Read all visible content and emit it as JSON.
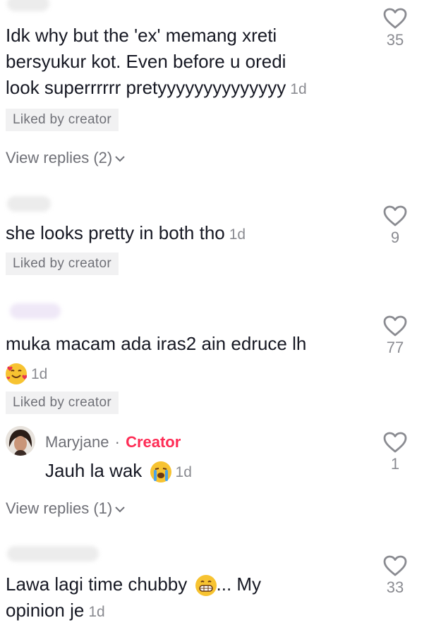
{
  "comments": [
    {
      "lines": [
        "Idk why but the 'ex' memang xreti",
        "bersyukur kot. Even before u oredi",
        "look superrrrrr pretyyyyyyyyyyyyyy"
      ],
      "time": "1d",
      "liked_label": "Liked by creator",
      "likes": "35",
      "view_replies": "View replies (2)"
    },
    {
      "lines": [
        "she looks pretty in both tho"
      ],
      "time": "1d",
      "liked_label": "Liked by creator",
      "likes": "9"
    },
    {
      "lines": [
        "muka macam ada iras2 ain edruce lh"
      ],
      "emoji": "smiling-face-with-hearts",
      "time": "1d",
      "liked_label": "Liked by creator",
      "likes": "77"
    },
    {
      "username": "Maryjane",
      "separator": "·",
      "creator_badge": "Creator",
      "text": "Jauh la wak",
      "emoji": "loudly-crying-face",
      "time": "1d",
      "likes": "1",
      "view_replies": "View replies (1)"
    },
    {
      "lines": [
        "Lawa lagi time chubby",
        "opinion je"
      ],
      "inline_emoji": "grinning-face",
      "inline_after": "... My",
      "time": "1d",
      "likes": "33"
    }
  ],
  "colors": {
    "creator": "#fe2c55",
    "muted": "#8a8b91",
    "chip_bg": "#f1f1f2"
  }
}
